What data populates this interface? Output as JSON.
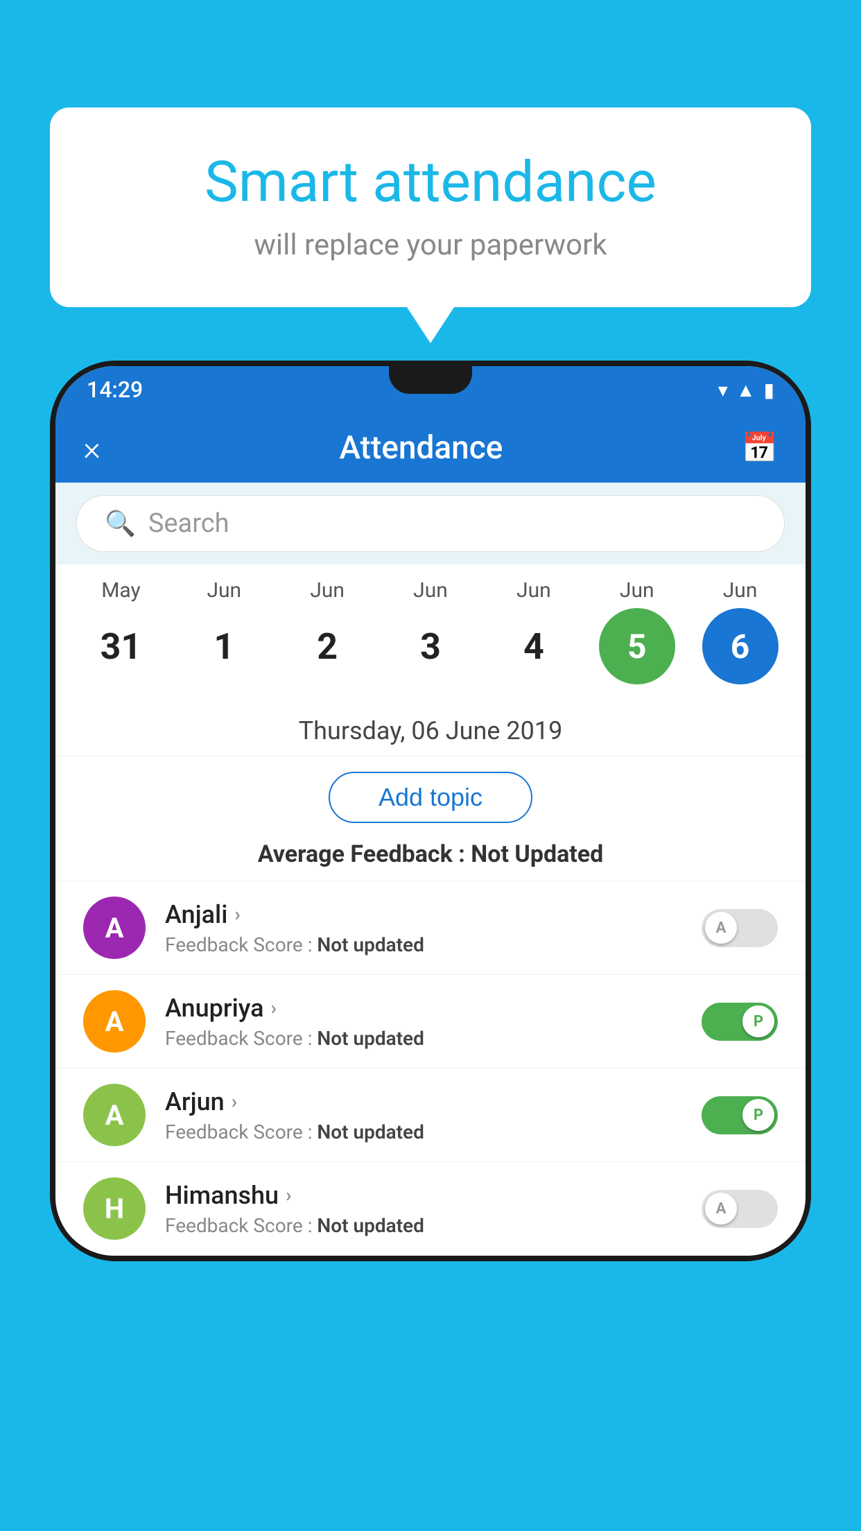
{
  "background_color": "#1ab8e8",
  "speech_bubble": {
    "title": "Smart attendance",
    "subtitle": "will replace your paperwork"
  },
  "status_bar": {
    "time": "14:29",
    "icons": [
      "wifi",
      "signal",
      "battery"
    ]
  },
  "app_header": {
    "close_label": "×",
    "title": "Attendance",
    "calendar_icon": "📅"
  },
  "search": {
    "placeholder": "Search"
  },
  "calendar": {
    "columns": [
      {
        "month": "May",
        "date": "31",
        "state": "normal"
      },
      {
        "month": "Jun",
        "date": "1",
        "state": "normal"
      },
      {
        "month": "Jun",
        "date": "2",
        "state": "normal"
      },
      {
        "month": "Jun",
        "date": "3",
        "state": "normal"
      },
      {
        "month": "Jun",
        "date": "4",
        "state": "normal"
      },
      {
        "month": "Jun",
        "date": "5",
        "state": "today"
      },
      {
        "month": "Jun",
        "date": "6",
        "state": "selected"
      }
    ]
  },
  "selected_date": "Thursday, 06 June 2019",
  "add_topic_label": "Add topic",
  "average_feedback": {
    "label": "Average Feedback : ",
    "value": "Not Updated"
  },
  "students": [
    {
      "name": "Anjali",
      "avatar_letter": "A",
      "avatar_color": "#9c27b0",
      "feedback_label": "Feedback Score : ",
      "feedback_value": "Not updated",
      "attendance": "absent",
      "toggle_letter": "A"
    },
    {
      "name": "Anupriya",
      "avatar_letter": "A",
      "avatar_color": "#ff9800",
      "feedback_label": "Feedback Score : ",
      "feedback_value": "Not updated",
      "attendance": "present",
      "toggle_letter": "P"
    },
    {
      "name": "Arjun",
      "avatar_letter": "A",
      "avatar_color": "#8bc34a",
      "feedback_label": "Feedback Score : ",
      "feedback_value": "Not updated",
      "attendance": "present",
      "toggle_letter": "P"
    },
    {
      "name": "Himanshu",
      "avatar_letter": "H",
      "avatar_color": "#8bc34a",
      "feedback_label": "Feedback Score : ",
      "feedback_value": "Not updated",
      "attendance": "absent",
      "toggle_letter": "A"
    }
  ]
}
